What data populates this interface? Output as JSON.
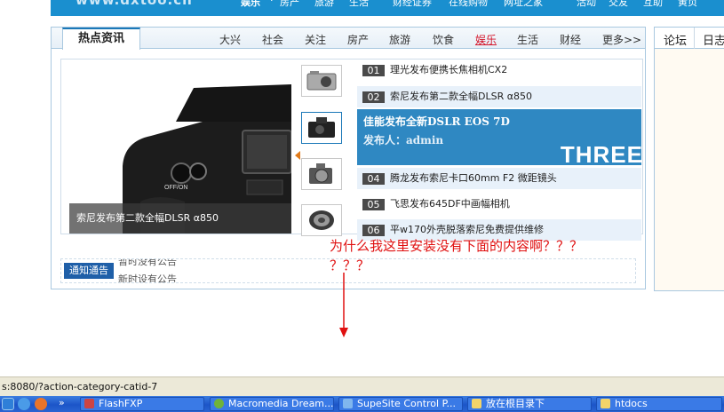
{
  "topbar": {
    "logo_text": "www.dxtoo.cn",
    "nav": [
      "娱乐",
      "·",
      "房产",
      "旅游",
      "生活",
      "财经证券",
      "在线购物",
      "网址之家",
      "活动",
      "交友",
      "互助",
      "黄页"
    ]
  },
  "panel": {
    "active_tab": "热点资讯",
    "categories": [
      "大兴",
      "社会",
      "关注",
      "房产",
      "旅游",
      "饮食",
      "娱乐",
      "生活",
      "财经",
      "更多>>"
    ],
    "selected_category": "娱乐",
    "photo_caption": "索尼发布第二款全幅DLSR α850",
    "news": [
      {
        "num": "01",
        "title": "理光发布便携长焦相机CX2"
      },
      {
        "num": "02",
        "title": "索尼发布第二款全幅DLSR α850"
      },
      {
        "num": "04",
        "title": "腾龙发布索尼卡口60mm F2 微距镜头"
      },
      {
        "num": "05",
        "title": "飞思发布645DF中画幅相机"
      },
      {
        "num": "06",
        "title": "平w170外壳脱落索尼免费提供维修"
      }
    ],
    "feature": {
      "title": "佳能发布全新DSLR EOS 7D",
      "publisher": "发布人：admin",
      "watermark": "THREE"
    },
    "notice": {
      "label": "通知通告",
      "lines": [
        "暂时没有公告",
        "新时设有公告"
      ]
    }
  },
  "side_panel": {
    "tabs": [
      "论坛",
      "日志"
    ]
  },
  "annotation": {
    "line1": "为什么我这里安装没有下面的内容啊？？？",
    "line2": "？？？"
  },
  "statusbar": {
    "text": "s:8080/?action-category-catid-7"
  },
  "taskbar": {
    "tasks": [
      "FlashFXP",
      "Macromedia Dream...",
      "SupeSite Control P...",
      "放在根目录下",
      "htdocs"
    ]
  },
  "colors": {
    "accent": "#1a78b8",
    "feature_bg": "#2f88c2",
    "annotation": "#e01010",
    "selected_category": "#d4162b"
  }
}
